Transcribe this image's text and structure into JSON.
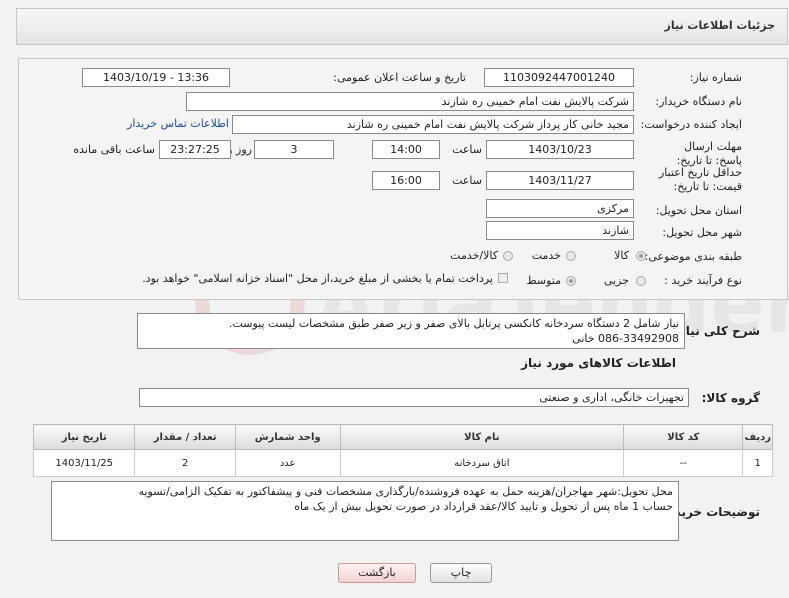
{
  "header": {
    "title": "جزئیات اطلاعات نیاز"
  },
  "form": {
    "need_number_label": "شماره نیاز:",
    "need_number": "1103092447001240",
    "announce_label": "تاریخ و ساعت اعلان عمومی:",
    "announce_value": "1403/10/19 - 13:36",
    "buyer_org_label": "نام دستگاه خریدار:",
    "buyer_org": "شرکت پالایش نفت امام خمینی  ره  شازند",
    "creator_label": "ایجاد کننده درخواست:",
    "creator": "مجید خانی کار پرداز شرکت پالایش نفت امام خمینی  ره  شازند",
    "contact_link": "اطلاعات تماس خریدار",
    "deadline_label": "مهلت ارسال پاسخ: تا تاریخ:",
    "deadline_date": "1403/10/23",
    "time_label": "ساعت",
    "deadline_time": "14:00",
    "days_value": "3",
    "days_label": "روز و",
    "remaining_time": "23:27:25",
    "remaining_label": "ساعت باقی مانده",
    "validity_label": "حداقل تاریخ اعتبار قیمت: تا تاریخ:",
    "validity_date": "1403/11/27",
    "validity_time": "16:00",
    "province_label": "استان محل تحویل:",
    "province": "مرکزی",
    "city_label": "شهر محل تحویل:",
    "city": "شازند",
    "category_label": "طبقه بندی موضوعی:",
    "cat_goods": "کالا",
    "cat_service": "خدمت",
    "cat_goods_service": "کالا/خدمت",
    "process_label": "نوع فرآیند خرید :",
    "proc_partial": "جزیی",
    "proc_medium": "متوسط",
    "proc_note": "پرداخت تمام یا بخشی از مبلغ خرید،از محل \"اسناد خزانه اسلامی\" خواهد بود."
  },
  "description": {
    "label": "شرح کلی نیاز:",
    "line1": "نیاز شامل 2 دستگاه سردخانه کانکسی پرتابل بالای صفر و زیر صفر طبق مشخصات لیست پیوست.",
    "line2": "086-33492908 خانی"
  },
  "goods_info": {
    "title": "اطلاعات کالاهای مورد نیاز",
    "group_label": "گروه کالا:",
    "group_value": "تجهیزات خانگی، اداری و صنعتی"
  },
  "table": {
    "headers": [
      "ردیف",
      "کد کالا",
      "نام کالا",
      "واحد شمارش",
      "تعداد / مقدار",
      "تاریخ نیاز"
    ],
    "rows": [
      [
        "1",
        "--",
        "اتاق سردخانه",
        "عدد",
        "2",
        "1403/11/25"
      ]
    ]
  },
  "buyer_notes": {
    "label": "توضیحات خریدار:",
    "line1": "محل تحویل:شهر مهاجران/هزینه حمل به عهده فروشنده/بارگذاری مشخصات فنی و پیشفاکتور به تفکیک الزامی/تسویه",
    "line2": "حساب 1 ماه پس از تحویل و تایید کالا/عقد قرارداد در صورت تحویل بیش از یک ماه"
  },
  "buttons": {
    "print": "چاپ",
    "back": "بازگشت"
  }
}
